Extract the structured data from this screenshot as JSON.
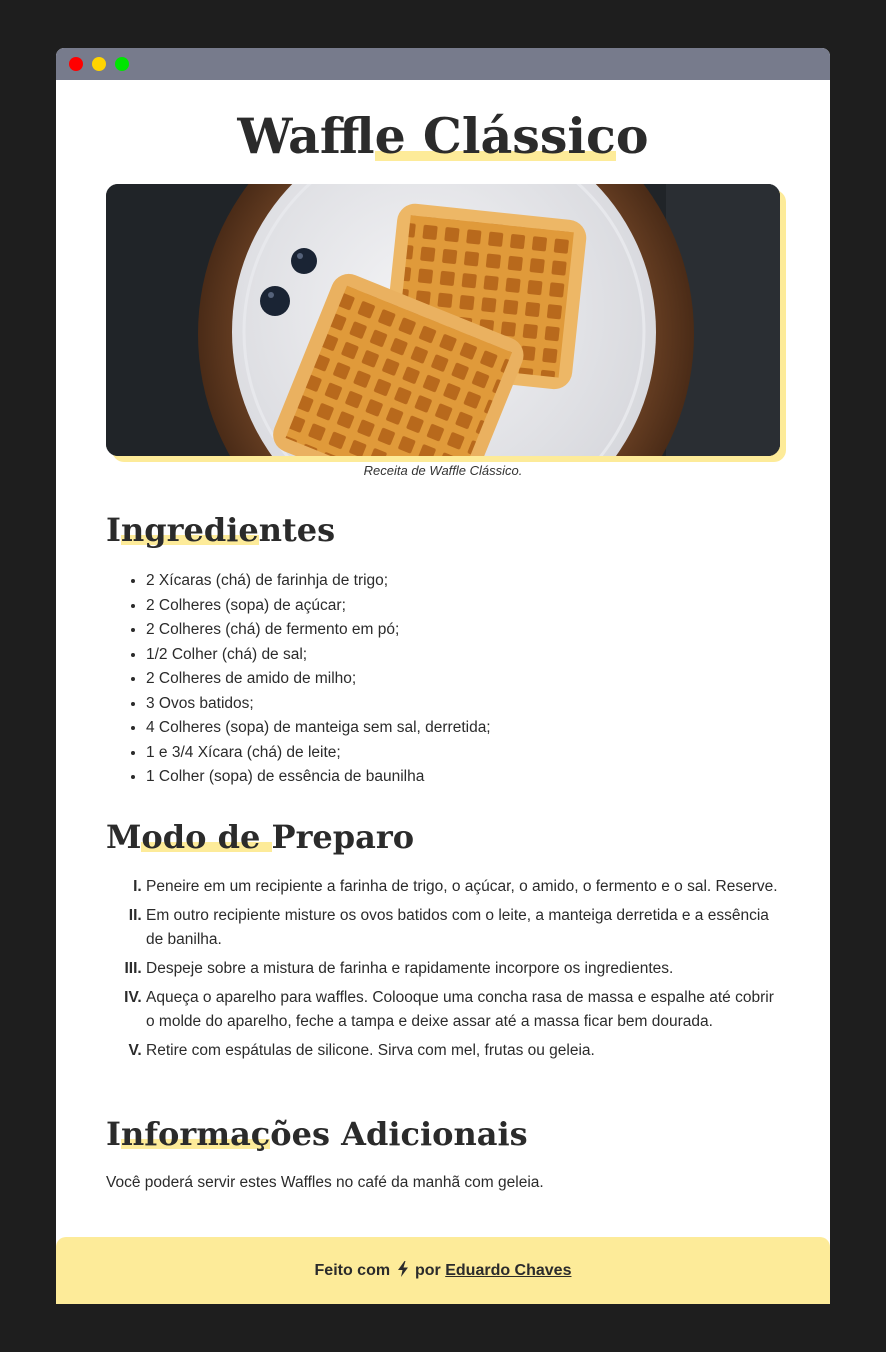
{
  "window": {
    "controls": [
      "close",
      "minimize",
      "maximize"
    ]
  },
  "page": {
    "title_pre": "Waf",
    "title_hl": "fle Clássic",
    "title_post": "o"
  },
  "image": {
    "caption": "Receita de Waffle Clássico."
  },
  "ingredients": {
    "heading_pre": "I",
    "heading_hl": "ngredie",
    "heading_post": "ntes",
    "items": [
      "2 Xícaras (chá) de farinhja de trigo;",
      "2 Colheres (sopa) de açúcar;",
      "2 Colheres (chá) de fermento em pó;",
      "1/2 Colher (chá) de sal;",
      "2 Colheres de amido de milho;",
      "3 Ovos batidos;",
      "4 Colheres (sopa) de manteiga sem sal, derretida;",
      "1 e 3/4 Xícara (chá) de leite;",
      "1 Colher (sopa) de essência de baunilha"
    ]
  },
  "preparation": {
    "heading_pre": "M",
    "heading_hl": "odo de ",
    "heading_post": "Preparo",
    "steps": [
      "Peneire em um recipiente a farinha de trigo, o açúcar, o amido, o fermento e o sal. Reserve.",
      "Em outro recipiente misture os ovos batidos com o leite, a manteiga derretida e a essência de banilha.",
      "Despeje sobre a mistura de farinha e rapidamente incorpore os ingredientes.",
      "Aqueça o aparelho para waffles. Colooque uma concha rasa de massa e espalhe até cobrir o molde do aparelho, feche a tampa e deixe assar até a massa ficar bem dourada.",
      "Retire com espátulas de silicone. Sirva com mel, frutas ou geleia."
    ]
  },
  "additional": {
    "heading_pre": "I",
    "heading_hl": "nformaç",
    "heading_post": "ões Adicionais",
    "text": "Você poderá servir estes Waffles no café da manhã com geleia."
  },
  "footer": {
    "made_with": "Feito com",
    "by": "por",
    "author": "Eduardo Chaves",
    "icon": "lightning-bolt-icon"
  },
  "colors": {
    "background": "#1e1e1e",
    "titlebar": "#777b8c",
    "highlight": "#fdeb99",
    "text": "#2b2b2b"
  }
}
